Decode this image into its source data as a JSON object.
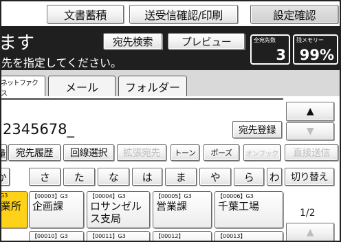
{
  "top": {
    "doc_storage": "文書蓄積",
    "tx_status": "送受信確認/印刷",
    "settings": "設定確認"
  },
  "header": {
    "title": "ます",
    "instruction": "先を指定してください。",
    "dest_search": "宛先検索",
    "preview": "プレビュー",
    "total_dest_label": "全宛先数",
    "total_dest_value": "3",
    "memory_label": "残メモリー",
    "memory_value": "99%"
  },
  "tabs": {
    "netfax": "ネットファクス",
    "mail": "メール",
    "folder": "フォルダー"
  },
  "entry": {
    "number": "2345678_"
  },
  "nav": {
    "up": "▲",
    "down": "▼",
    "page": "1/2"
  },
  "actions": {
    "register": "宛先登録",
    "partial": "量",
    "history": "宛先履歴",
    "line_select": "回線選択",
    "ext_dest": "拡張宛先",
    "tone": "トーン",
    "pause": "ポーズ",
    "on_hook": "オンフック",
    "direct_send": "直接送信"
  },
  "kana": [
    "か",
    "さ",
    "た",
    "な",
    "は",
    "ま",
    "や",
    "ら",
    "わ"
  ],
  "kana_switch": "切り替え",
  "destinations": [
    {
      "code": "G3",
      "name": "業所"
    },
    {
      "code": "【00003】G3",
      "name": "企画課"
    },
    {
      "code": "【00004】G3",
      "name": "ロサンゼル\nス支局"
    },
    {
      "code": "【00005】G3",
      "name": "営業課"
    },
    {
      "code": "【00006】G3",
      "name": "千葉工場"
    }
  ],
  "destinations_row2": [
    "【00010】G3",
    "【00011】G3",
    "【00012】",
    "【00013】"
  ],
  "colors": {
    "header_bg": "#1f1f1f",
    "selected_card": "#ffd21a",
    "accent_ring": "#f0a020"
  }
}
